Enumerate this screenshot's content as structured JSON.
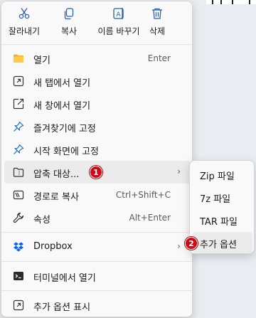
{
  "toolbar": {
    "cut_label": "잘라내기",
    "copy_label": "복사",
    "rename_label": "이름 바꾸기",
    "delete_label": "삭제"
  },
  "menu": {
    "items": [
      {
        "label": "열기",
        "shortcut": "Enter",
        "icon": "folder-icon"
      },
      {
        "label": "새 탭에서 열기",
        "icon": "new-tab-icon"
      },
      {
        "label": "새 창에서 열기",
        "icon": "new-window-icon"
      },
      {
        "label": "즐겨찾기에 고정",
        "icon": "pin-icon"
      },
      {
        "label": "시작 화면에 고정",
        "icon": "pin-icon"
      },
      {
        "label": "압축 대상...",
        "icon": "zip-folder-icon"
      },
      {
        "label": "경로로 복사",
        "shortcut": "Ctrl+Shift+C",
        "icon": "path-icon"
      },
      {
        "label": "속성",
        "shortcut": "Alt+Enter",
        "icon": "wrench-icon"
      },
      {
        "label": "Dropbox",
        "icon": "dropbox-icon"
      },
      {
        "label": "터미널에서 열기",
        "icon": "terminal-icon"
      },
      {
        "label": "추가 옵션 표시",
        "icon": "more-options-icon"
      }
    ]
  },
  "submenu": {
    "items": [
      "Zip 파일",
      "7z 파일",
      "TAR 파일",
      "추가 옵션"
    ]
  },
  "badges": {
    "first": "1",
    "second": "2"
  },
  "colors": {
    "badge": "#cc0a17",
    "folder": "#f0b429",
    "dropbox": "#0061fe",
    "accent_blue": "#1f6fc5"
  }
}
